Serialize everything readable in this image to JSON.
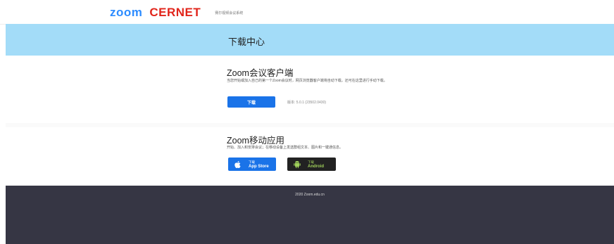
{
  "header": {
    "logo_zoom": "zoom",
    "logo_cernet": "CERNET",
    "logo_sub": "赛尔视频会议系统"
  },
  "banner": {
    "title": "下载中心"
  },
  "client_section": {
    "title": "Zoom会议客户端",
    "description": "当您开始或加入自己的第一个Zoom会议时，网页浏览器客户端将自动下载。还可在这里进行手动下载。",
    "download_label": "下载",
    "version": "版本: 5.0.1 (23502.0430)"
  },
  "mobile_section": {
    "title": "Zoom移动应用",
    "description": "开始、加入和安排会议；在移动设备上发送群组文本、图片和一键通信息。",
    "appstore": {
      "small": "下载",
      "big": "App Store"
    },
    "android": {
      "small": "下载",
      "big": "Android"
    }
  },
  "footer": {
    "copyright": "2020 Zoom.edu.cn"
  },
  "colors": {
    "banner": "#a3dcf8",
    "primary": "#1a73e8",
    "footer": "#363644",
    "cernet_red": "#e1251b",
    "zoom_blue": "#2d8cff"
  },
  "icons": {
    "appstore": "apple-icon",
    "android": "android-icon"
  }
}
